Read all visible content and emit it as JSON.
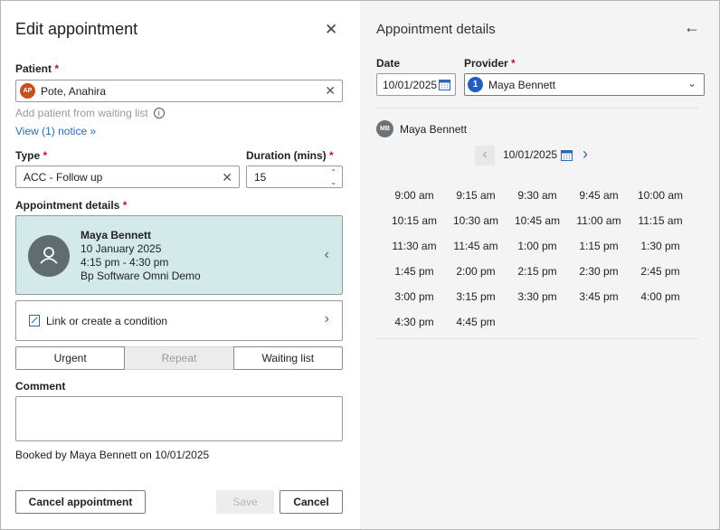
{
  "left": {
    "title": "Edit appointment",
    "patient": {
      "label": "Patient",
      "initials": "AP",
      "value": "Pote, Anahira",
      "add_from_waiting": "Add patient from waiting list",
      "notice_link": "View (1) notice"
    },
    "type": {
      "label": "Type",
      "value": "ACC - Follow up"
    },
    "duration": {
      "label": "Duration (mins)",
      "value": "15"
    },
    "appointment_details": {
      "label": "Appointment details",
      "provider": "Maya Bennett",
      "date": "10 January 2025",
      "time": "4:15 pm - 4:30 pm",
      "location": "Bp Software Omni Demo"
    },
    "condition_link": "Link or create a condition",
    "segments": [
      "Urgent",
      "Repeat",
      "Waiting list"
    ],
    "comment": {
      "label": "Comment",
      "value": ""
    },
    "booked_by": "Booked by Maya Bennett on 10/01/2025",
    "buttons": {
      "cancel_appointment": "Cancel appointment",
      "save": "Save",
      "cancel": "Cancel"
    }
  },
  "right": {
    "title": "Appointment details",
    "date_label": "Date",
    "date_value": "10/01/2025",
    "provider_label": "Provider",
    "provider_badge": "1",
    "provider_value": "Maya Bennett",
    "schedule_initials": "MB",
    "schedule_provider": "Maya Bennett",
    "nav_date": "10/01/2025",
    "slots": [
      "9:00 am",
      "9:15 am",
      "9:30 am",
      "9:45 am",
      "10:00 am",
      "10:15 am",
      "10:30 am",
      "10:45 am",
      "11:00 am",
      "11:15 am",
      "11:30 am",
      "11:45 am",
      "1:00 pm",
      "1:15 pm",
      "1:30 pm",
      "1:45 pm",
      "2:00 pm",
      "2:15 pm",
      "2:30 pm",
      "2:45 pm",
      "3:00 pm",
      "3:15 pm",
      "3:30 pm",
      "3:45 pm",
      "4:00 pm",
      "4:30 pm",
      "4:45 pm"
    ]
  },
  "colors": {
    "accent": "#2b6cb0",
    "required": "#c8102e",
    "card_bg": "#d3e9ea",
    "panel_bg": "#f4f4f4"
  }
}
